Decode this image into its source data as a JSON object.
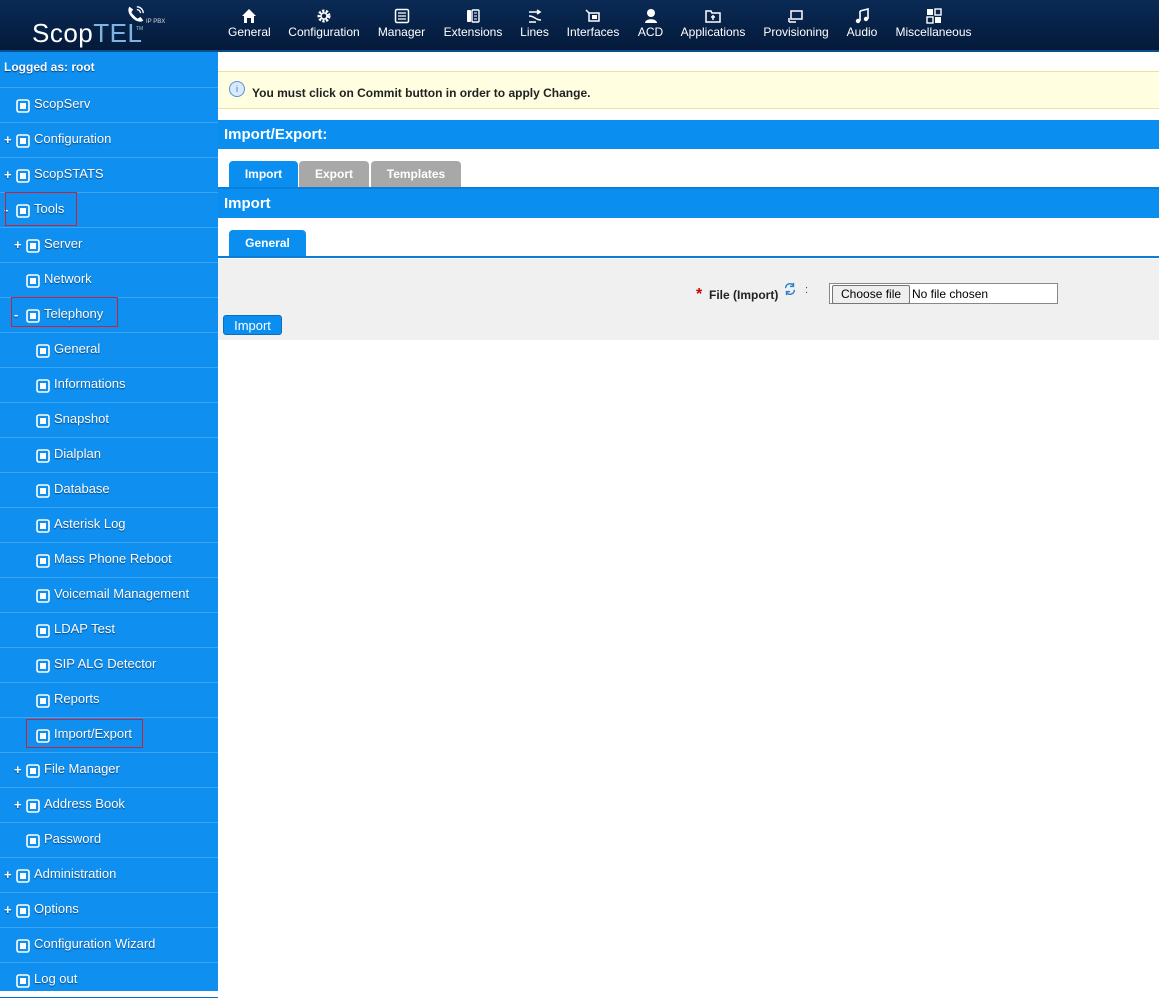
{
  "logo": {
    "scop": "Scop",
    "tel": "TEL",
    "tm": "TM",
    "ippbx": "IP PBX"
  },
  "topnav": [
    {
      "label": "General",
      "icon": "home-icon"
    },
    {
      "label": "Configuration",
      "icon": "gear-icon"
    },
    {
      "label": "Manager",
      "icon": "list-icon"
    },
    {
      "label": "Extensions",
      "icon": "phone-icon"
    },
    {
      "label": "Lines",
      "icon": "lines-icon"
    },
    {
      "label": "Interfaces",
      "icon": "interfaces-icon"
    },
    {
      "label": "ACD",
      "icon": "agent-icon"
    },
    {
      "label": "Applications",
      "icon": "applications-icon"
    },
    {
      "label": "Provisioning",
      "icon": "provisioning-icon"
    },
    {
      "label": "Audio",
      "icon": "music-icon"
    },
    {
      "label": "Miscellaneous",
      "icon": "grid-icon"
    }
  ],
  "sidebar": {
    "logged_as": "Logged as: root",
    "items": [
      {
        "prefix": "",
        "label": "ScopServ",
        "icon": "home-icon"
      },
      {
        "prefix": "+",
        "label": "Configuration",
        "icon": "gear-icon"
      },
      {
        "prefix": "+",
        "label": "ScopSTATS",
        "icon": "chart-icon"
      },
      {
        "prefix": "-",
        "label": "Tools",
        "icon": "tools-icon"
      },
      {
        "prefix": "+",
        "label": "Server",
        "icon": "server-icon"
      },
      {
        "prefix": "",
        "label": "Network",
        "icon": "network-icon"
      },
      {
        "prefix": "-",
        "label": "Telephony",
        "icon": "telephony-icon"
      },
      {
        "prefix": "",
        "label": "General",
        "icon": "home-icon"
      },
      {
        "prefix": "",
        "label": "Informations",
        "icon": "monitor-icon"
      },
      {
        "prefix": "",
        "label": "Snapshot",
        "icon": "gear-icon"
      },
      {
        "prefix": "",
        "label": "Dialplan",
        "icon": "dialplan-icon"
      },
      {
        "prefix": "",
        "label": "Database",
        "icon": "database-icon"
      },
      {
        "prefix": "",
        "label": "Asterisk Log",
        "icon": "document-icon"
      },
      {
        "prefix": "",
        "label": "Mass Phone Reboot",
        "icon": "reboot-icon"
      },
      {
        "prefix": "",
        "label": "Voicemail Management",
        "icon": "voicemail-icon"
      },
      {
        "prefix": "",
        "label": "LDAP Test",
        "icon": "ldap-icon"
      },
      {
        "prefix": "",
        "label": "SIP ALG Detector",
        "icon": "sip-icon"
      },
      {
        "prefix": "",
        "label": "Reports",
        "icon": "chart-icon"
      },
      {
        "prefix": "",
        "label": "Import/Export",
        "icon": "import-export-icon"
      },
      {
        "prefix": "+",
        "label": "File Manager",
        "icon": "folder-icon"
      },
      {
        "prefix": "+",
        "label": "Address Book",
        "icon": "address-book-icon"
      },
      {
        "prefix": "",
        "label": "Password",
        "icon": "lock-icon"
      },
      {
        "prefix": "+",
        "label": "Administration",
        "icon": "admin-icon"
      },
      {
        "prefix": "+",
        "label": "Options",
        "icon": "gear-icon"
      },
      {
        "prefix": "",
        "label": "Configuration Wizard",
        "icon": "wizard-icon"
      },
      {
        "prefix": "",
        "label": "Log out",
        "icon": "logout-icon"
      }
    ]
  },
  "notice": {
    "message": "You must click on Commit button in order to apply Change."
  },
  "main": {
    "section_title": "Import/Export:",
    "tabs": [
      {
        "label": "Import"
      },
      {
        "label": "Export"
      },
      {
        "label": "Templates"
      }
    ],
    "subsection_title": "Import",
    "subtabs": [
      {
        "label": "General"
      }
    ],
    "form": {
      "required_mark": "*",
      "file_label": "File (Import)",
      "colon": ":",
      "choose_file": "Choose file",
      "no_file": "No file chosen",
      "submit": "Import"
    }
  },
  "colors": {
    "accent": "#0a8ff0",
    "sidebar": "#0f8ff0",
    "topbar": "#0a2a55",
    "highlight": "#c8213a"
  }
}
